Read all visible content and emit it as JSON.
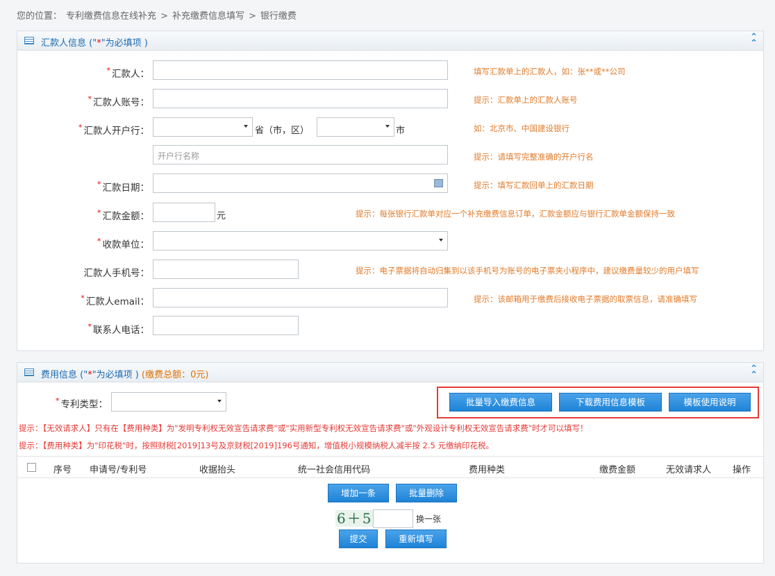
{
  "breadcrumb": {
    "prefix": "您的位置：",
    "items": [
      "专利缴费信息在线补充",
      ">",
      "补充缴费信息填写",
      ">",
      "银行缴费"
    ]
  },
  "remitter_panel": {
    "title_a": "汇款人信息 (\"",
    "title_star": "*",
    "title_b": "\"为必填项 )",
    "fields": {
      "name": {
        "label": "汇款人：",
        "hint": "填写汇款单上的汇款人，如：张**或**公司"
      },
      "account": {
        "label": "汇款人账号：",
        "hint": "提示：汇款单上的汇款人账号"
      },
      "bank": {
        "label": "汇款人开户行：",
        "province_unit": "省（市，区）",
        "city_unit": "市",
        "hint": "如：北京市、中国建设银行"
      },
      "bank_name": {
        "placeholder": "开户行名称",
        "hint": "提示：请填写完整准确的开户行名"
      },
      "date": {
        "label": "汇款日期：",
        "hint": "提示：填写汇款回单上的汇款日期"
      },
      "amount": {
        "label": "汇款金额：",
        "unit": "元",
        "hint": "提示：每张银行汇款单对应一个补充缴费信息订单，汇款金额应与银行汇款单金额保持一致"
      },
      "payee": {
        "label": "收款单位："
      },
      "phone": {
        "label": "汇款人手机号：",
        "hint": "提示：电子票据将自动归集到以该手机号为账号的电子票夹小程序中，建议缴费量较少的用户填写"
      },
      "email": {
        "label": "汇款人email：",
        "hint": "提示：该邮箱用于缴费后接收电子票据的取票信息，请准确填写"
      },
      "contact": {
        "label": "联系人电话："
      }
    }
  },
  "fee_panel": {
    "title_a": "费用信息 (\"",
    "title_star": "*",
    "title_b": "\"为必填项 )",
    "total": "(缴费总额：0元)",
    "patent_type_label": "专利类型：",
    "buttons": {
      "import": "批量导入缴费信息",
      "download": "下载费用信息模板",
      "guide": "模板使用说明"
    },
    "warn1": "提示：【无效请求人】只有在【费用种类】为\"发明专利权无效宣告请求费\"或\"实用新型专利权无效宣告请求费\"或\"外观设计专利权无效宣告请求费\"时才可以填写！",
    "warn2": "提示：【费用种类】为\"印花税\"时，按照财税[2019]13号及京财税[2019]196号通知，增值税小规模纳税人减半按 2.5 元缴纳印花税。",
    "columns": [
      "序号",
      "申请号/专利号",
      "收据抬头",
      "统一社会信用代码",
      "费用种类",
      "缴费金额",
      "无效请求人",
      "操作"
    ],
    "add_row": "增加一条",
    "batch_delete": "批量删除",
    "captcha_text": "6＋5",
    "captcha_refresh": "换一张",
    "submit": "提交",
    "reset": "重新填写"
  },
  "colors": {
    "accent": "#1f83d6",
    "hint": "#e07b2a",
    "warning": "#e53935",
    "title": "#1e6bb0"
  }
}
